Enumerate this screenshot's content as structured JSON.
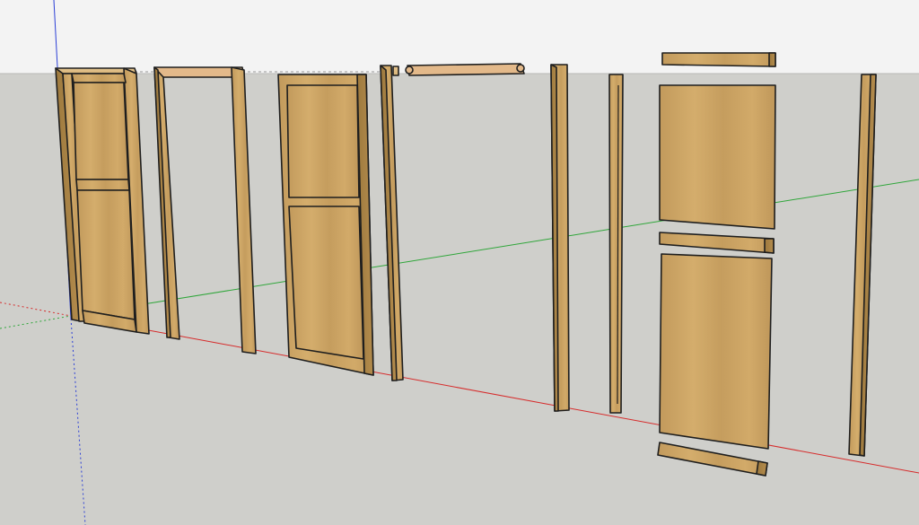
{
  "scene": {
    "sky_color": "#f3f3f3",
    "ground_color": "#cfcfcb",
    "wood_color": "#c9a062",
    "wood_dark": "#a9803f",
    "edge_color": "#1e1e1e",
    "axis_red": "#d62b2b",
    "axis_green": "#2fa63a",
    "axis_blue": "#2b3fd6",
    "objects": [
      {
        "name": "assembled-door",
        "kind": "door-assembly"
      },
      {
        "name": "door-frame",
        "kind": "frame"
      },
      {
        "name": "door-leaf",
        "kind": "panel-door"
      },
      {
        "name": "door-jamb-with-head",
        "kind": "jamb"
      },
      {
        "name": "door-head-rail",
        "kind": "rail"
      },
      {
        "name": "door-stile-left",
        "kind": "stile"
      },
      {
        "name": "door-stile-grooved",
        "kind": "stile"
      },
      {
        "name": "door-top-rail",
        "kind": "rail"
      },
      {
        "name": "door-upper-panel",
        "kind": "panel"
      },
      {
        "name": "door-middle-rail",
        "kind": "rail"
      },
      {
        "name": "door-lower-panel",
        "kind": "panel"
      },
      {
        "name": "door-bottom-rail",
        "kind": "rail"
      },
      {
        "name": "door-stile-right",
        "kind": "stile"
      }
    ]
  }
}
